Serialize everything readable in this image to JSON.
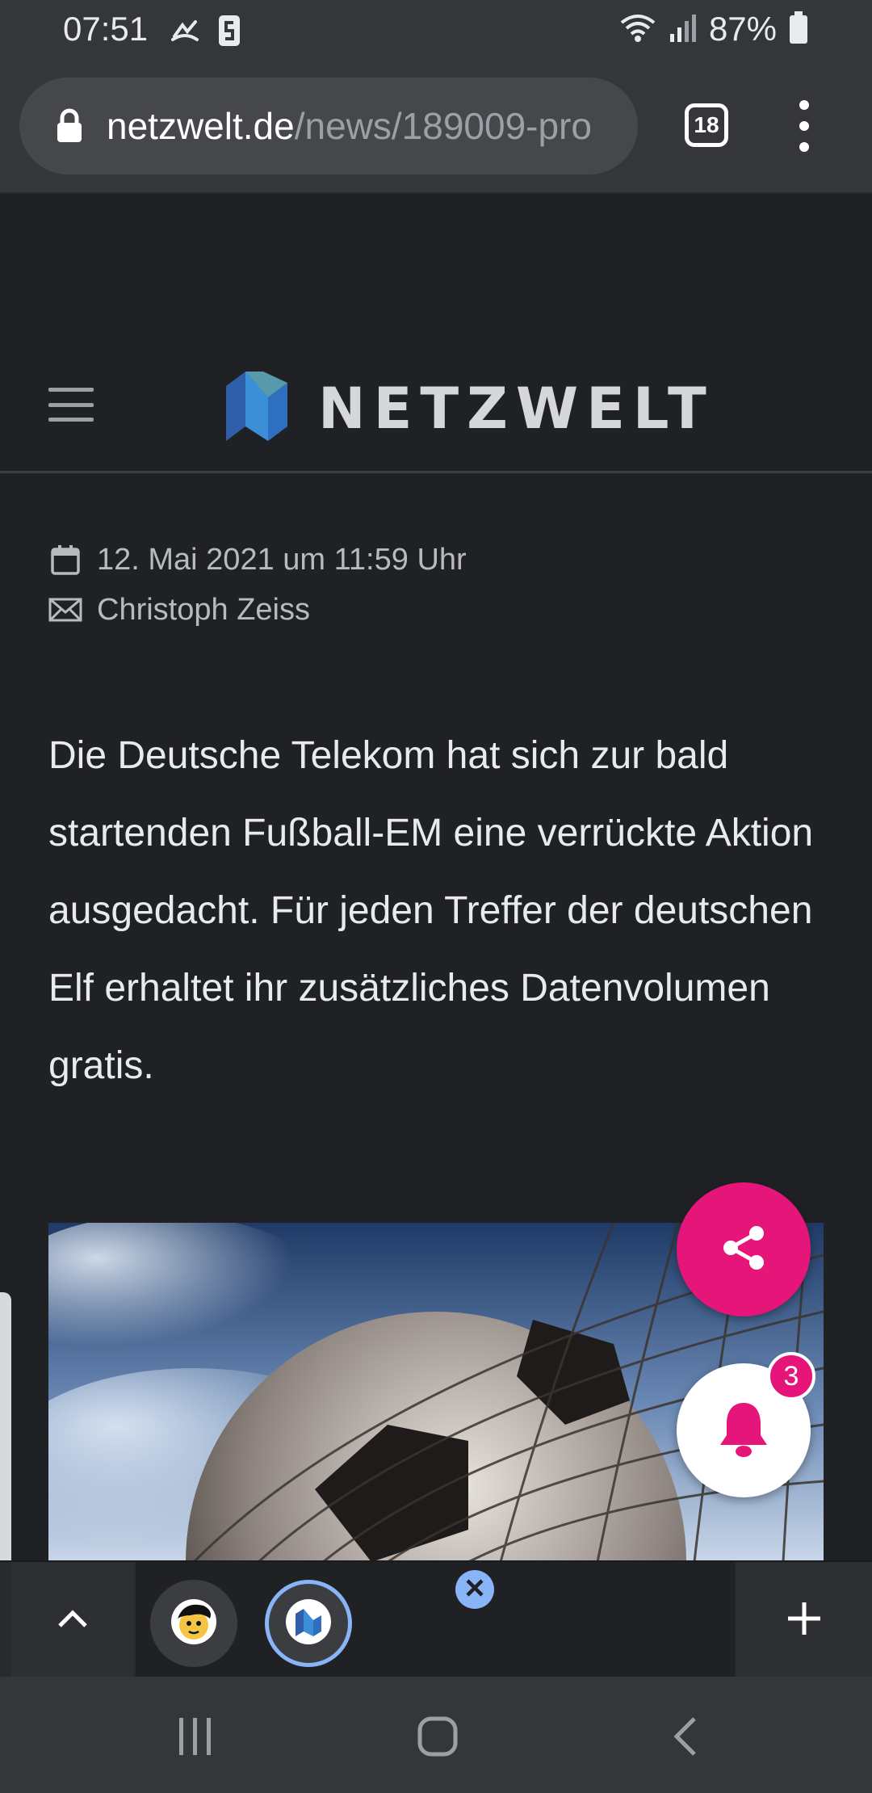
{
  "status_bar": {
    "time": "07:51",
    "battery": "87%",
    "icons_left": [
      "missed-call-icon",
      "s-app-icon"
    ],
    "icons_right": [
      "wifi-icon",
      "signal-icon",
      "battery-icon"
    ]
  },
  "browser": {
    "url_domain": "netzwelt.de",
    "url_path": "/news/189009-pro",
    "tab_count": "18"
  },
  "site": {
    "logo_text": "NETZWELT"
  },
  "article": {
    "date": "12. Mai 2021 um 11:59 Uhr",
    "author": "Christoph Zeiss",
    "lead": "Die Deutsche Telekom hat sich zur bald startenden Fußball-EM eine verrückte Aktion ausgedacht. Für jeden Treffer der deutschen Elf erhaltet ihr zusätzliches Datenvolumen gratis."
  },
  "notifications": {
    "badge_count": "3"
  },
  "colors": {
    "accent_pink": "#e5157a",
    "tab_active_blue": "#8ab4f8",
    "logo_blue": "#2f7fc8"
  }
}
